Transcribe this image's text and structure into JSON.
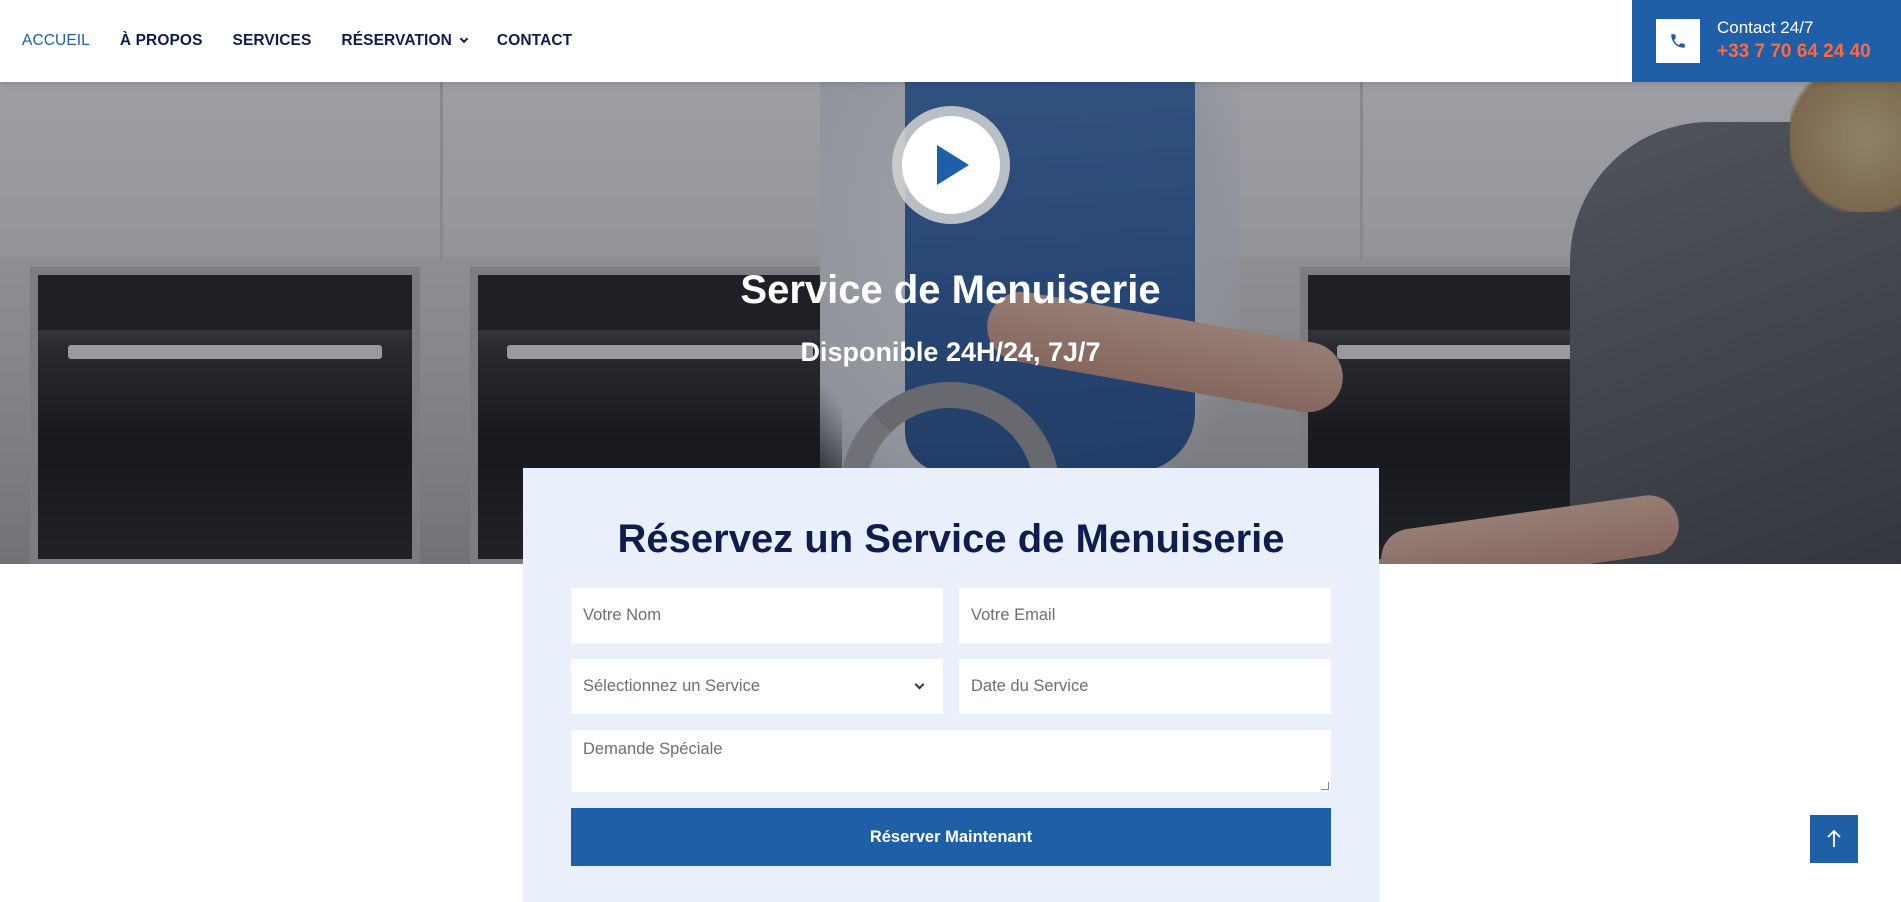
{
  "nav": {
    "items": [
      {
        "label": "ACCUEIL",
        "active": true
      },
      {
        "label": "À PROPOS"
      },
      {
        "label": "SERVICES"
      },
      {
        "label": "RÉSERVATION",
        "dropdown": true
      },
      {
        "label": "CONTACT"
      }
    ]
  },
  "contact": {
    "label": "Contact 24/7",
    "phone": "+33 7 70 64 24 40",
    "icon": "phone-icon"
  },
  "hero": {
    "title": "Service de Menuiserie",
    "subtitle": "Disponible 24H/24, 7J/7",
    "play_icon": "play-icon"
  },
  "form": {
    "title": "Réservez un Service de Menuiserie",
    "name_placeholder": "Votre Nom",
    "email_placeholder": "Votre Email",
    "service_selected": "Sélectionnez un Service",
    "date_placeholder": "Date du Service",
    "request_placeholder": "Demande Spéciale",
    "submit_label": "Réserver Maintenant"
  },
  "colors": {
    "primary": "#1e5fa8",
    "dark_navy": "#0f1d4d",
    "accent_orange": "#ff6a3d",
    "form_bg": "#eaf0fb"
  }
}
